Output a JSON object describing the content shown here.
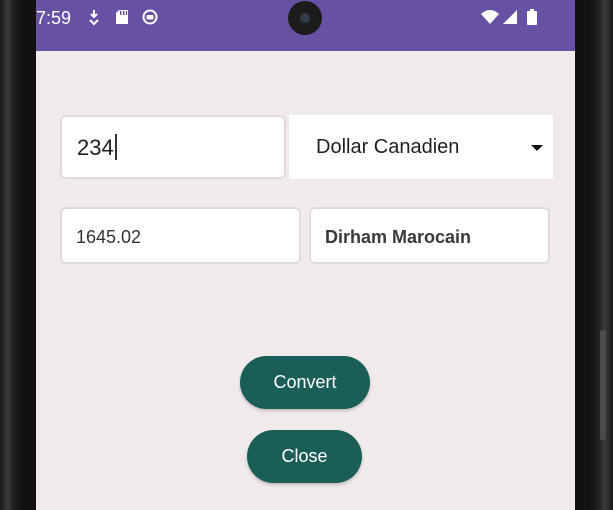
{
  "status_bar": {
    "time": "7:59",
    "color": "#6751a5",
    "left_icons": [
      "download-icon",
      "sd-card-icon",
      "app-notification-icon"
    ],
    "right_icons": [
      "wifi-icon",
      "cellular-signal-icon",
      "battery-icon"
    ]
  },
  "converter": {
    "amount_value": "234",
    "source_currency": "Dollar Canadien",
    "result_value": "1645.02",
    "target_currency": "Dirham Marocain"
  },
  "buttons": {
    "convert_label": "Convert",
    "close_label": "Close",
    "color": "#1b5e57"
  },
  "colors": {
    "background": "#f1eaeb",
    "field_border": "#e0dadb"
  }
}
